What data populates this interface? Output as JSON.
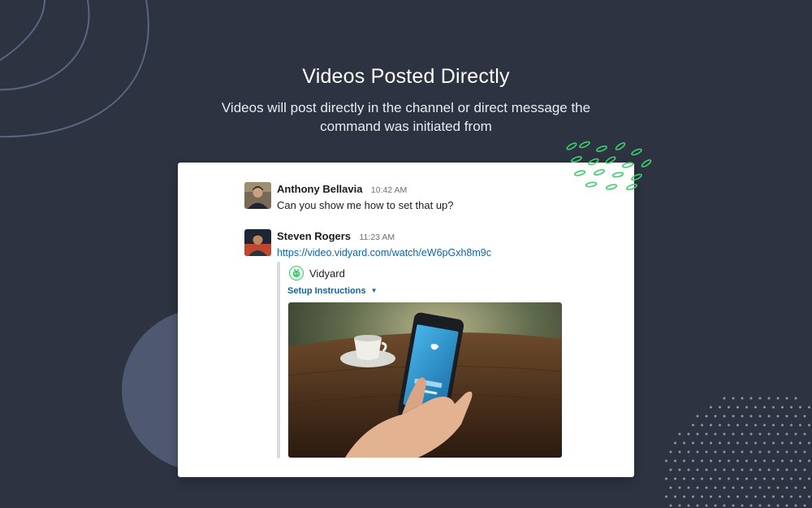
{
  "hero": {
    "title": "Videos Posted Directly",
    "subtitle": "Videos will post directly in the channel or direct message the command was initiated from"
  },
  "messages": [
    {
      "author": "Anthony Bellavia",
      "time": "10:42 AM",
      "text": "Can you show me how to set that up?",
      "avatar_icon": "person-avatar"
    },
    {
      "author": "Steven Rogers",
      "time": "11:23 AM",
      "link": "https://video.vidyard.com/watch/eW6pGxh8m9c",
      "avatar_icon": "person-avatar",
      "attachment": {
        "service_name": "Vidyard",
        "service_icon": "vidyard-logo-icon",
        "title": "Setup Instructions",
        "dropdown_icon": "caret-down-icon"
      }
    }
  ],
  "colors": {
    "background": "#2d3341",
    "card": "#ffffff",
    "link": "#1264a3",
    "accent_green": "#3ecf6e"
  }
}
